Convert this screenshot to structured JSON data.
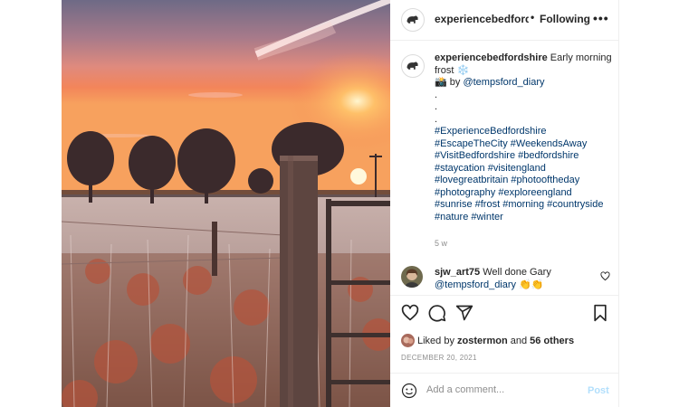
{
  "post": {
    "username": "experiencebedfordshire",
    "dot": "•",
    "follow_label": "Following",
    "more_label": "•••"
  },
  "caption": {
    "username": "experiencebedfordshire",
    "text": "Early morning frost",
    "snow_emoji": "❄️",
    "camera_emoji": "📸",
    "by_label": "by",
    "mention": "@tempsford_diary",
    "dots": [
      ".",
      ".",
      "."
    ],
    "hashtag_lines": [
      "#ExperienceBedfordshire",
      "#EscapeTheCity #WeekendsAway",
      "#VisitBedfordshire #bedfordshire",
      "#staycation #visitengland",
      "#lovegreatbritain #photooftheday",
      "#photography #exploreengland",
      "#sunrise #frost #morning #countryside",
      "#nature #winter"
    ],
    "age": "5 w"
  },
  "comment": {
    "username": "sjw_art75",
    "text": "Well done Gary",
    "mention": "@tempsford_diary",
    "emoji": "👏👏"
  },
  "actions": {
    "icons": [
      "heart-icon",
      "comment-icon",
      "share-icon",
      "bookmark-icon"
    ]
  },
  "likes": {
    "prefix": "Liked by",
    "user": "zostermon",
    "and_label": "and",
    "others": "56 others"
  },
  "date": "DECEMBER 20, 2021",
  "add_comment": {
    "placeholder": "Add a comment...",
    "post_label": "Post"
  },
  "colors": {
    "link": "#00376b",
    "muted": "#8e8e8e",
    "post_disabled": "#b2dffc",
    "sky_top": "#6e6a86",
    "sky_glow": "#f07a52",
    "sun": "#fff3c8"
  }
}
